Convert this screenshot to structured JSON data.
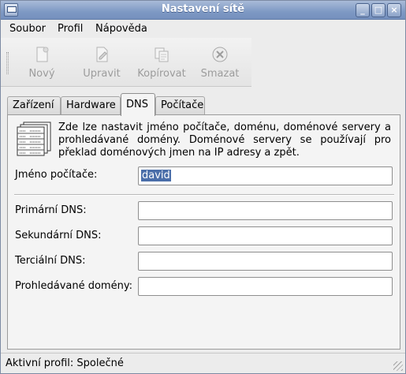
{
  "window": {
    "title": "Nastavení sítě"
  },
  "menubar": {
    "items": [
      "Soubor",
      "Profil",
      "Nápověda"
    ]
  },
  "toolbar": {
    "buttons": [
      {
        "label": "Nový",
        "icon": "new-document-icon",
        "enabled": false
      },
      {
        "label": "Upravit",
        "icon": "edit-icon",
        "enabled": false
      },
      {
        "label": "Kopírovat",
        "icon": "copy-icon",
        "enabled": false
      },
      {
        "label": "Smazat",
        "icon": "delete-icon",
        "enabled": false
      }
    ]
  },
  "tabs": {
    "items": [
      "Zařízení",
      "Hardware",
      "DNS",
      "Počítače"
    ],
    "active": "DNS"
  },
  "dns": {
    "description": "Zde lze nastavit jméno počítače, doménu, doménové servery a prohledávané domény. Doménové servery se používají pro překlad doménových jmen na IP adresy a zpět.",
    "hostname_label": "Jméno počítače:",
    "hostname_value": "david",
    "primary_label": "Primární DNS:",
    "primary_value": "",
    "secondary_label": "Sekundární DNS:",
    "secondary_value": "",
    "tertiary_label": "Terciální DNS:",
    "tertiary_value": "",
    "search_label": "Prohledávané domény:",
    "search_value": ""
  },
  "status": {
    "text": "Aktivní profil: Společné"
  },
  "colors": {
    "titlebar": "#7e99c4",
    "selection": "#4a6ea9"
  }
}
